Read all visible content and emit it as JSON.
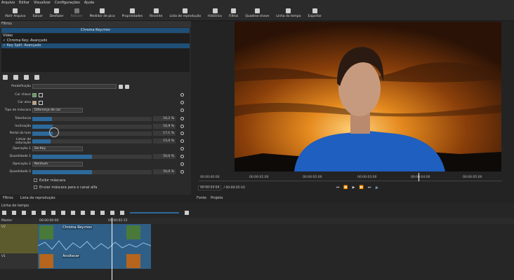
{
  "menu": [
    "Arquivo",
    "Editar",
    "Visualizar",
    "Configurações",
    "Ajuda"
  ],
  "toolbar": [
    {
      "label": "Abrir Arquivo",
      "icon": "open-icon"
    },
    {
      "label": "Salvar",
      "icon": "save-icon"
    },
    {
      "label": "Desfazer",
      "icon": "undo-icon"
    },
    {
      "label": "Refazer",
      "icon": "redo-icon",
      "dim": true
    },
    {
      "label": "Medidor de pico",
      "icon": "meter-icon"
    },
    {
      "label": "Propriedades",
      "icon": "info-icon"
    },
    {
      "label": "Recente",
      "icon": "clock-icon"
    },
    {
      "label": "Lista de reprodução",
      "icon": "list-icon"
    },
    {
      "label": "Histórico",
      "icon": "history-icon"
    },
    {
      "label": "Filtros",
      "icon": "filter-icon"
    },
    {
      "label": "Quadros-chave",
      "icon": "keyframe-icon"
    },
    {
      "label": "Linha do tempo",
      "icon": "timeline-icon"
    },
    {
      "label": "Exportar",
      "icon": "export-icon"
    }
  ],
  "filters": {
    "title": "Filtros",
    "clip": "Chroma Key.mov",
    "group": "Vídeo",
    "items": [
      "✓ Chroma Key: Avançado",
      "✓ Key Spill: Avançado"
    ],
    "preset_label": "Predefinição",
    "key_color_label": "Cor chave",
    "key_color": "#5aa05a",
    "target_color_label": "Cor alvo",
    "target_color": "#c8a07a",
    "mask_type_label": "Tipo de máscara",
    "mask_type": "Diferença de cor",
    "tolerance_label": "Tolerância",
    "tolerance": "16,2 %",
    "tolerance_frac": 0.162,
    "slope_label": "Inclinação",
    "slope": "16,9 %",
    "slope_frac": 0.169,
    "hue_gate_label": "Portal do tom",
    "hue_gate": "17,1 %",
    "hue_gate_frac": 0.171,
    "sat_label": "Limiar de saturação",
    "sat": "15,0 %",
    "sat_frac": 0.15,
    "op1_label": "Operação 1",
    "op1": "De-Key",
    "amt1_label": "Quantidade 1",
    "amt1": "50,0 %",
    "amt1_frac": 0.5,
    "op2_label": "Operação 2",
    "op2": "Nenhum",
    "amt2_label": "Quantidade 2",
    "amt2": "50,0 %",
    "amt2_frac": 0.5,
    "show_mask": "Exibir máscara",
    "send_mask": "Enviar máscara para o canal alfa",
    "tabs": [
      "Filtros",
      "Lista de reprodução"
    ]
  },
  "viewer": {
    "ticks": [
      "00:00:00:00",
      "00:00:01:00",
      "00:00:02:00",
      "00:00:03:00",
      "00:00:04:00",
      "00:00:05:00"
    ],
    "current": "00:00:04:04",
    "total": "/ 00:00:05:10",
    "tabs": [
      "Fonte",
      "Projeto"
    ]
  },
  "timeline": {
    "title": "Linha do tempo",
    "master": "Master",
    "ruler_start": "00:00:00:00",
    "ruler_mid": "00:00:02:15",
    "v2": "V2",
    "v1": "V1",
    "v2_clip": "Chroma Key.mov",
    "v1_clip": "Anoitecer"
  }
}
